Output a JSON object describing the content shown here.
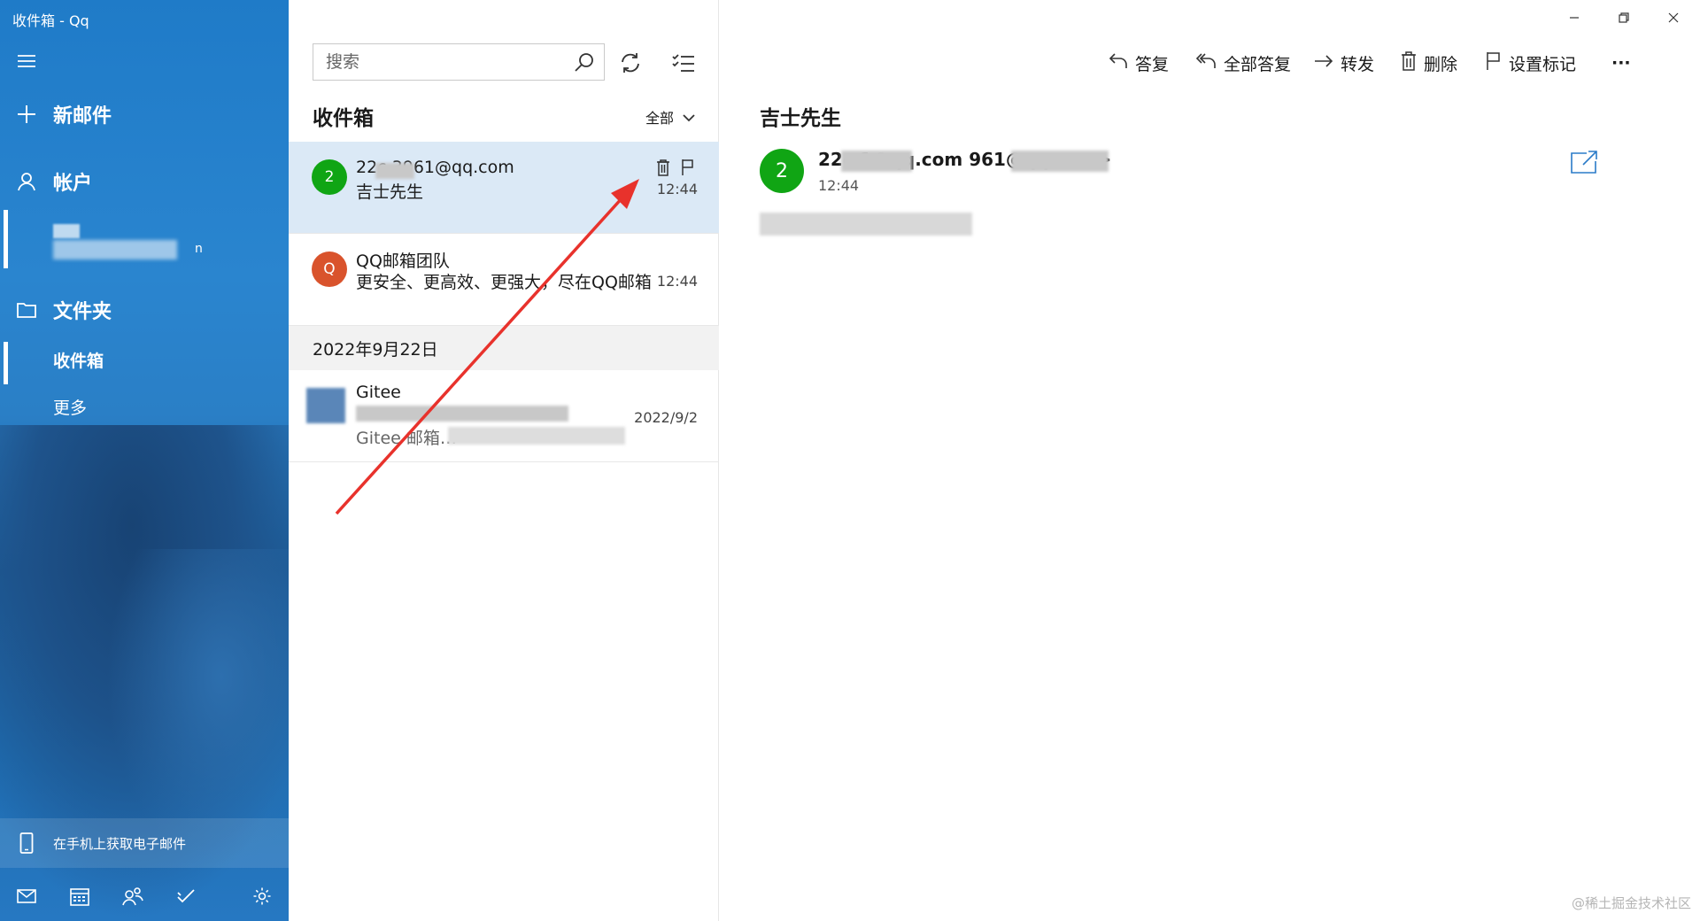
{
  "window": {
    "title": "收件箱 - Qq"
  },
  "sidebar": {
    "new_mail": "新邮件",
    "accounts": "帐户",
    "account_tail": "n",
    "folders": "文件夹",
    "inbox": "收件箱",
    "more": "更多",
    "phone_prompt": "在手机上获取电子邮件"
  },
  "list": {
    "search_placeholder": "搜索",
    "title": "收件箱",
    "filter": "全部",
    "messages": [
      {
        "from": "22c   3961@qq.com",
        "subject": "吉士先生",
        "time": "12:44",
        "avatar": "2",
        "avatar_color": "#10a514"
      },
      {
        "from": "QQ邮箱团队",
        "subject": "更安全、更高效、更强大，尽在QQ邮箱",
        "time": "12:44",
        "avatar": "Q",
        "avatar_color": "#d9532c"
      }
    ],
    "date_header": "2022年9月22日",
    "older": {
      "from": "Gitee",
      "subject": "Gitee 邮箱…",
      "time": "2022/9/2"
    }
  },
  "reader": {
    "commands": {
      "reply": "答复",
      "reply_all": "全部答复",
      "forward": "转发",
      "delete": "删除",
      "flag": "设置标记",
      "more": "···"
    },
    "subject": "吉士先生",
    "avatar": "2",
    "from": "22c   1@qq.com   961@qq.com>",
    "time": "12:44"
  },
  "watermark": "@稀土掘金技术社区"
}
